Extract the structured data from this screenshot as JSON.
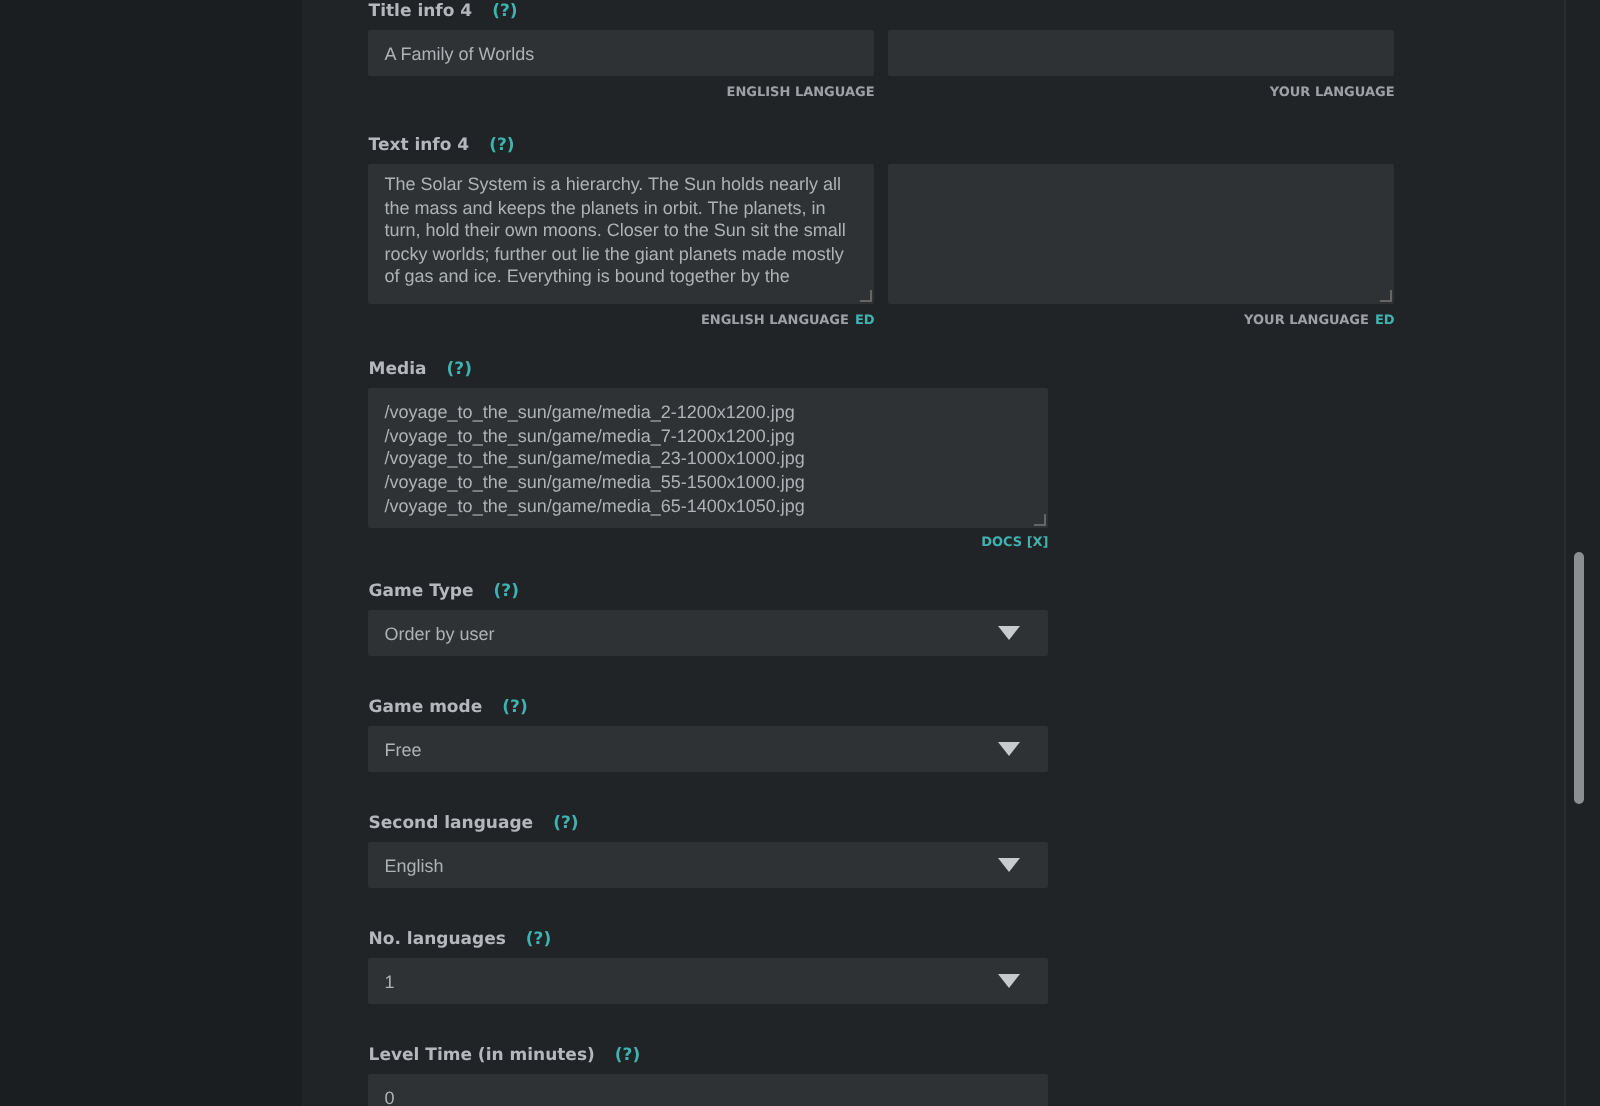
{
  "title_info": {
    "label": "Title info 4",
    "help": "(?)",
    "fields": [
      {
        "value": "A Family of Worlds",
        "caption": "ENGLISH LANGUAGE"
      },
      {
        "caption": "YOUR LANGUAGE"
      }
    ]
  },
  "text_info": {
    "label": "Text info 4",
    "help": "(?)",
    "fields": [
      {
        "value": "The Solar System is a hierarchy. The Sun holds nearly all the mass and keeps the planets in orbit. The planets, in turn, hold their own moons. Closer to the Sun sit the small rocky worlds; further out lie the giant planets made mostly of gas and ice. Everything is bound together by the",
        "caption": "ENGLISH LANGUAGE",
        "caption_link": "ED"
      },
      {
        "caption": "YOUR LANGUAGE",
        "caption_link": "ED"
      }
    ]
  },
  "media": {
    "label": "Media",
    "help": "(?)",
    "lines": [
      "/voyage_to_the_sun/game/media_2-1200x1200.jpg",
      "/voyage_to_the_sun/game/media_7-1200x1200.jpg",
      "/voyage_to_the_sun/game/media_23-1000x1000.jpg",
      "/voyage_to_the_sun/game/media_55-1500x1000.jpg",
      "/voyage_to_the_sun/game/media_65-1400x1050.jpg"
    ],
    "link": "DOCS [X]"
  },
  "settings": [
    {
      "kind": "select",
      "label": "Game Type",
      "help": "(?)",
      "value": "Order by user"
    },
    {
      "kind": "select",
      "label": "Game mode",
      "help": "(?)",
      "value": "Free"
    },
    {
      "kind": "select",
      "label": "Second language",
      "help": "(?)",
      "value": "English"
    },
    {
      "kind": "select",
      "label": "No. languages",
      "help": "(?)",
      "value": "1"
    },
    {
      "kind": "input",
      "label": "Level Time (in minutes)",
      "help": "(?)",
      "value": "0"
    }
  ]
}
